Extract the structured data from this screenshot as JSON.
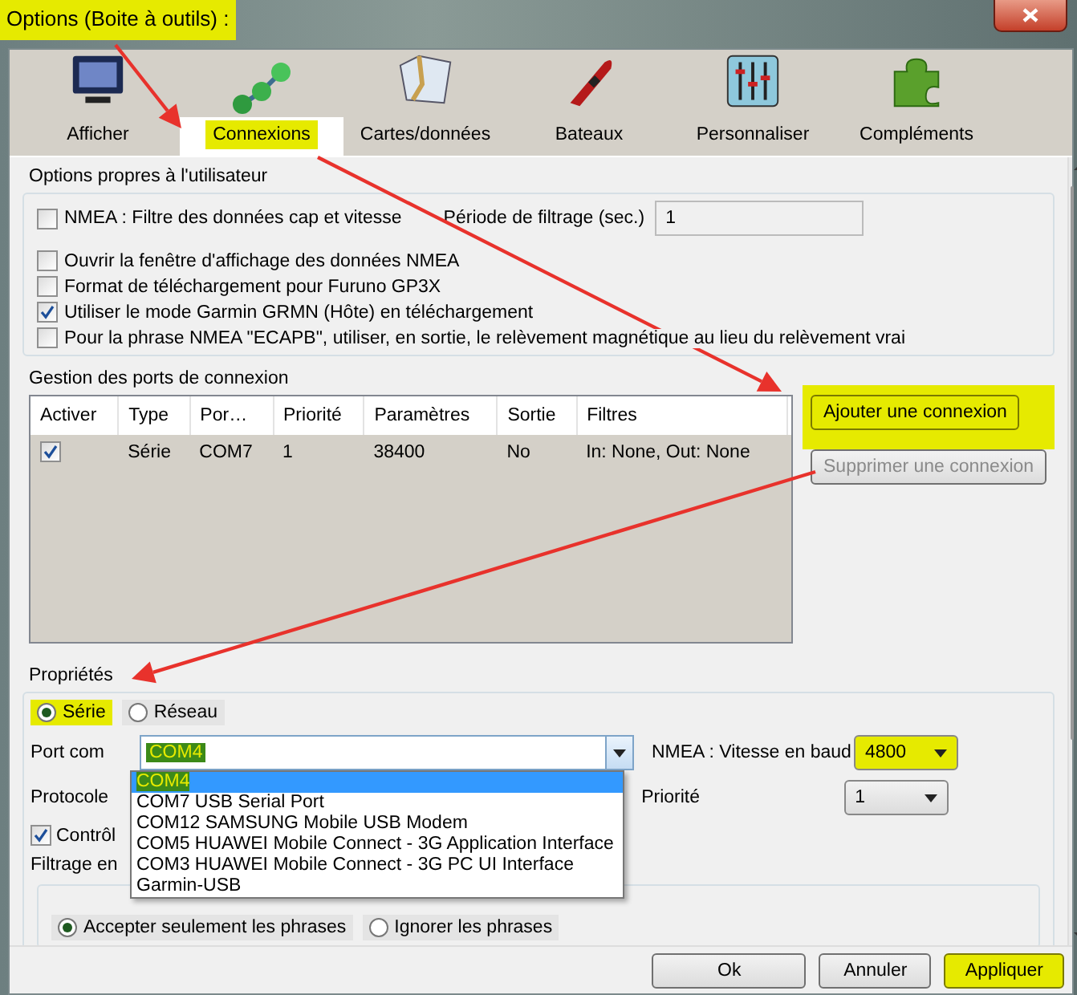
{
  "window": {
    "title": "Options (Boite à outils) :",
    "highlighted": true
  },
  "toolbar": [
    {
      "label": "Afficher",
      "kind": "monitor",
      "selected": false,
      "highlighted": false
    },
    {
      "label": "Connexions",
      "kind": "nodes",
      "selected": true,
      "highlighted": true
    },
    {
      "label": "Cartes/données",
      "kind": "map",
      "selected": false,
      "highlighted": false
    },
    {
      "label": "Bateaux",
      "kind": "boat",
      "selected": false,
      "highlighted": false
    },
    {
      "label": "Personnaliser",
      "kind": "sliders",
      "selected": false,
      "highlighted": false
    },
    {
      "label": "Compléments",
      "kind": "puzzle",
      "selected": false,
      "highlighted": false
    }
  ],
  "user_options": {
    "title": "Options propres à l'utilisateur",
    "filter": {
      "label": "NMEA : Filtre des données cap et vitesse",
      "checked": false,
      "period_label": "Période de filtrage (sec.)",
      "period_value": "1"
    },
    "checkboxes": [
      {
        "label": "Ouvrir la fenêtre d'affichage des données NMEA",
        "checked": false
      },
      {
        "label": "Format de téléchargement pour Furuno GP3X",
        "checked": false
      },
      {
        "label": "Utiliser le mode Garmin GRMN (Hôte) en téléchargement",
        "checked": true
      },
      {
        "label": "Pour la phrase NMEA \"ECAPB\", utiliser, en sortie, le relèvement magnétique  au lieu du relèvement vrai",
        "checked": false
      }
    ]
  },
  "ports": {
    "title": "Gestion des ports de connexion",
    "columns": [
      "Activer",
      "Type",
      "Por…",
      "Priorité",
      "Paramètres",
      "Sortie",
      "Filtres"
    ],
    "rows": [
      {
        "active": true,
        "cells": [
          "",
          "Série",
          "COM7",
          "1",
          "38400",
          "No",
          "In: None, Out: None"
        ]
      }
    ],
    "buttons": [
      {
        "label": "Ajouter une connexion",
        "disabled": false,
        "highlighted": true
      },
      {
        "label": "Supprimer une connexion",
        "disabled": true,
        "highlighted": false
      }
    ]
  },
  "properties": {
    "title": "Propriétés",
    "connection_types": [
      {
        "label": "Série",
        "selected": true,
        "highlighted": true
      },
      {
        "label": "Réseau",
        "selected": false,
        "highlighted": false
      }
    ],
    "port_label": "Port com",
    "port_value": "COM4",
    "port_expanded": true,
    "port_options": [
      {
        "label": "COM4",
        "selected": true
      },
      {
        "label": "COM7 USB Serial Port",
        "selected": false
      },
      {
        "label": "COM12 SAMSUNG Mobile USB Modem",
        "selected": false
      },
      {
        "label": "COM5 HUAWEI Mobile Connect - 3G Application Interface",
        "selected": false
      },
      {
        "label": "COM3 HUAWEI Mobile Connect - 3G PC UI Interface",
        "selected": false
      },
      {
        "label": "Garmin-USB",
        "selected": false
      }
    ],
    "baud_label": "NMEA : Vitesse en baud",
    "baud_value": "4800",
    "baud_highlighted": true,
    "protocol_label": "Protocole",
    "priority_label": "Priorité",
    "priority_value": "1",
    "checksum": {
      "label": "Contrôl",
      "checked": true
    },
    "filter_title": "Filtrage en",
    "filter_modes": [
      {
        "label": "Accepter seulement les phrases",
        "selected": true
      },
      {
        "label": "Ignorer les phrases",
        "selected": false
      }
    ]
  },
  "buttons": [
    {
      "label": "Ok",
      "highlighted": false
    },
    {
      "label": "Annuler",
      "highlighted": false
    },
    {
      "label": "Appliquer",
      "highlighted": true
    }
  ]
}
